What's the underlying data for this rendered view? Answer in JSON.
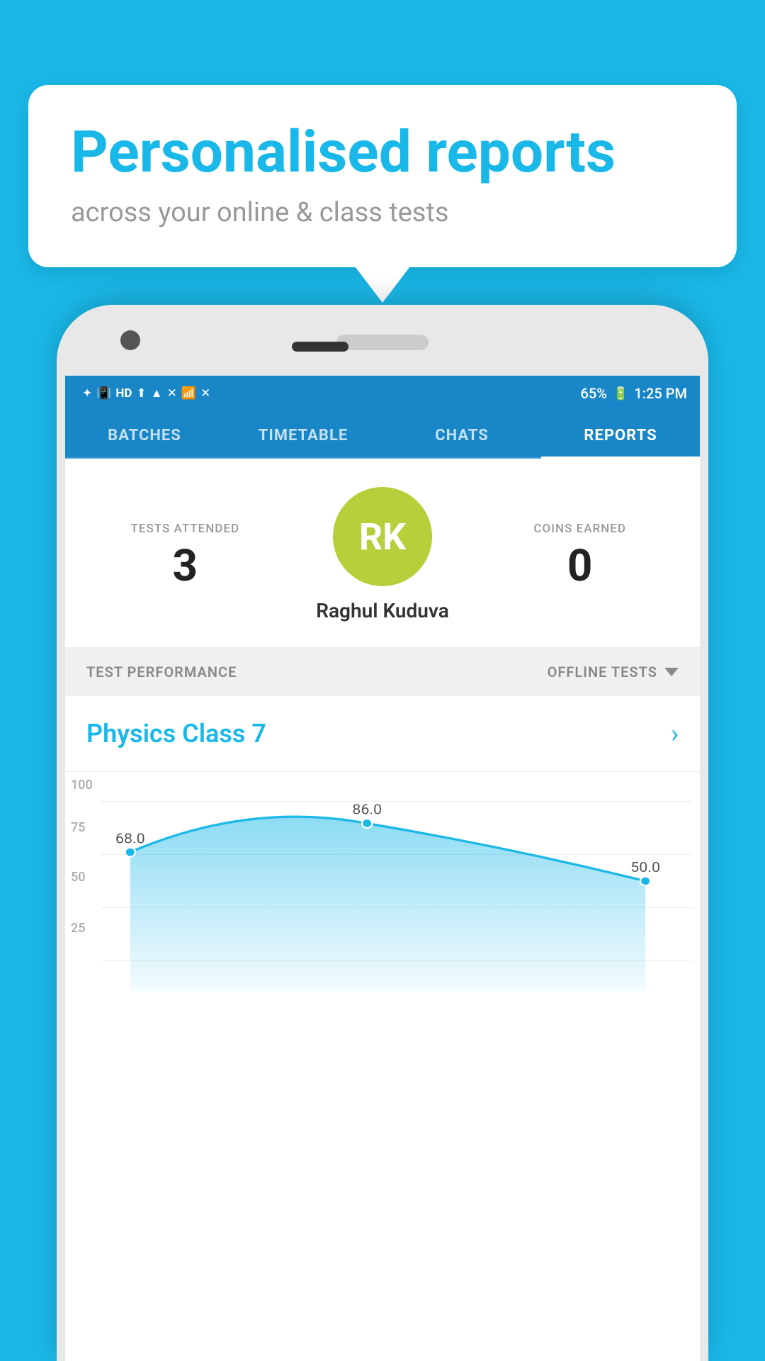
{
  "background": {
    "color": "#1ab8e8"
  },
  "speech_bubble": {
    "title": "Personalised reports",
    "subtitle": "across your online & class tests"
  },
  "status_bar": {
    "time": "1:25 PM",
    "battery": "65%",
    "signal_icons": "🔵 📳 HD ▲ ▼ 📶 ✕ 📶 ✕"
  },
  "nav_tabs": [
    {
      "label": "BATCHES",
      "active": false
    },
    {
      "label": "TIMETABLE",
      "active": false
    },
    {
      "label": "CHATS",
      "active": false
    },
    {
      "label": "REPORTS",
      "active": true
    }
  ],
  "user_card": {
    "tests_attended_label": "TESTS ATTENDED",
    "tests_attended_value": "3",
    "coins_earned_label": "COINS EARNED",
    "coins_earned_value": "0",
    "avatar_initials": "RK",
    "avatar_color": "#b8ce3a",
    "user_name": "Raghul Kuduva"
  },
  "test_performance": {
    "section_title": "TEST PERFORMANCE",
    "filter_label": "OFFLINE TESTS"
  },
  "class_row": {
    "class_name": "Physics Class 7"
  },
  "chart": {
    "y_labels": [
      "100",
      "75",
      "50",
      "25"
    ],
    "data_points": [
      {
        "label": "68.0",
        "value": 68,
        "x_pct": 5
      },
      {
        "label": "86.0",
        "value": 86,
        "x_pct": 45
      },
      {
        "label": "50.0",
        "value": 50,
        "x_pct": 92
      }
    ]
  }
}
